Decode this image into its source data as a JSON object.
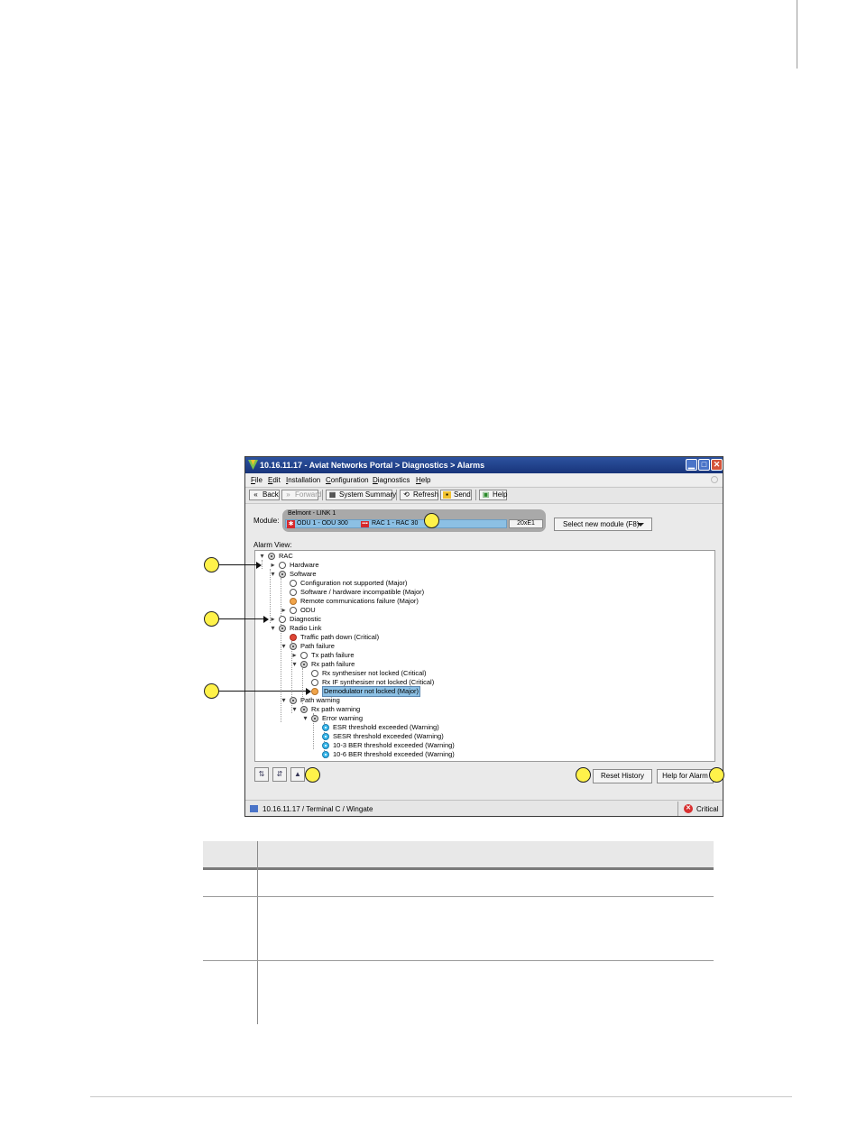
{
  "window": {
    "title": "10.16.11.17 - Aviat Networks Portal > Diagnostics > Alarms",
    "controls": [
      "minimize",
      "maximize",
      "close"
    ]
  },
  "menu": [
    "File",
    "Edit",
    "Installation",
    "Configuration",
    "Diagnostics",
    "Help"
  ],
  "toolbar": {
    "back": "Back",
    "forward": "Forward",
    "system_summary": "System Summary",
    "refresh": "Refresh",
    "send": "Send",
    "help": "Help"
  },
  "module": {
    "label": "Module:",
    "name": "Belmont - LINK 1",
    "odu": "ODU 1 - ODU 300",
    "rac": "RAC 1 - RAC 30",
    "capacity": "20xE1",
    "select_button": "Select new module (F8)"
  },
  "alarm_view": {
    "label": "Alarm View:",
    "nodes": [
      {
        "label": "RAC",
        "status": "group"
      },
      {
        "label": "Hardware",
        "status": "ok"
      },
      {
        "label": "Software",
        "status": "group"
      },
      {
        "label": "Configuration not supported (Major)",
        "status": "ok"
      },
      {
        "label": "Software / hardware incompatible (Major)",
        "status": "ok"
      },
      {
        "label": "Remote communications failure (Major)",
        "status": "major"
      },
      {
        "label": "ODU",
        "status": "ok"
      },
      {
        "label": "Diagnostic",
        "status": "ok"
      },
      {
        "label": "Radio Link",
        "status": "group"
      },
      {
        "label": "Traffic path down (Critical)",
        "status": "critical"
      },
      {
        "label": "Path failure",
        "status": "group"
      },
      {
        "label": "Tx path failure",
        "status": "ok"
      },
      {
        "label": "Rx path failure",
        "status": "group"
      },
      {
        "label": "Rx synthesiser not locked (Critical)",
        "status": "ok"
      },
      {
        "label": "Rx IF synthesiser not locked (Critical)",
        "status": "ok"
      },
      {
        "label": "Demodulator not locked (Major)",
        "status": "major",
        "selected": true
      },
      {
        "label": "Path warning",
        "status": "group"
      },
      {
        "label": "Rx path warning",
        "status": "group"
      },
      {
        "label": "Error warning",
        "status": "group"
      },
      {
        "label": "ESR threshold exceeded (Warning)",
        "status": "warning"
      },
      {
        "label": "SESR threshold exceeded (Warning)",
        "status": "warning"
      },
      {
        "label": "10-3 BER threshold exceeded (Warning)",
        "status": "warning"
      },
      {
        "label": "10-6 BER threshold exceeded (Warning)",
        "status": "warning"
      }
    ]
  },
  "footer": {
    "reset_history": "Reset History",
    "help_for_alarm": "Help for Alarm"
  },
  "statusbar": {
    "text": "10.16.11.17  /  Terminal C  /  Wingate",
    "severity": "Critical"
  },
  "colors": {
    "titlebar": "#2d52a0",
    "callout": "#fff24a",
    "major": "#f0a44a",
    "critical": "#e04636",
    "warning": "#3ab8ea",
    "selection": "#8cc0e4"
  }
}
